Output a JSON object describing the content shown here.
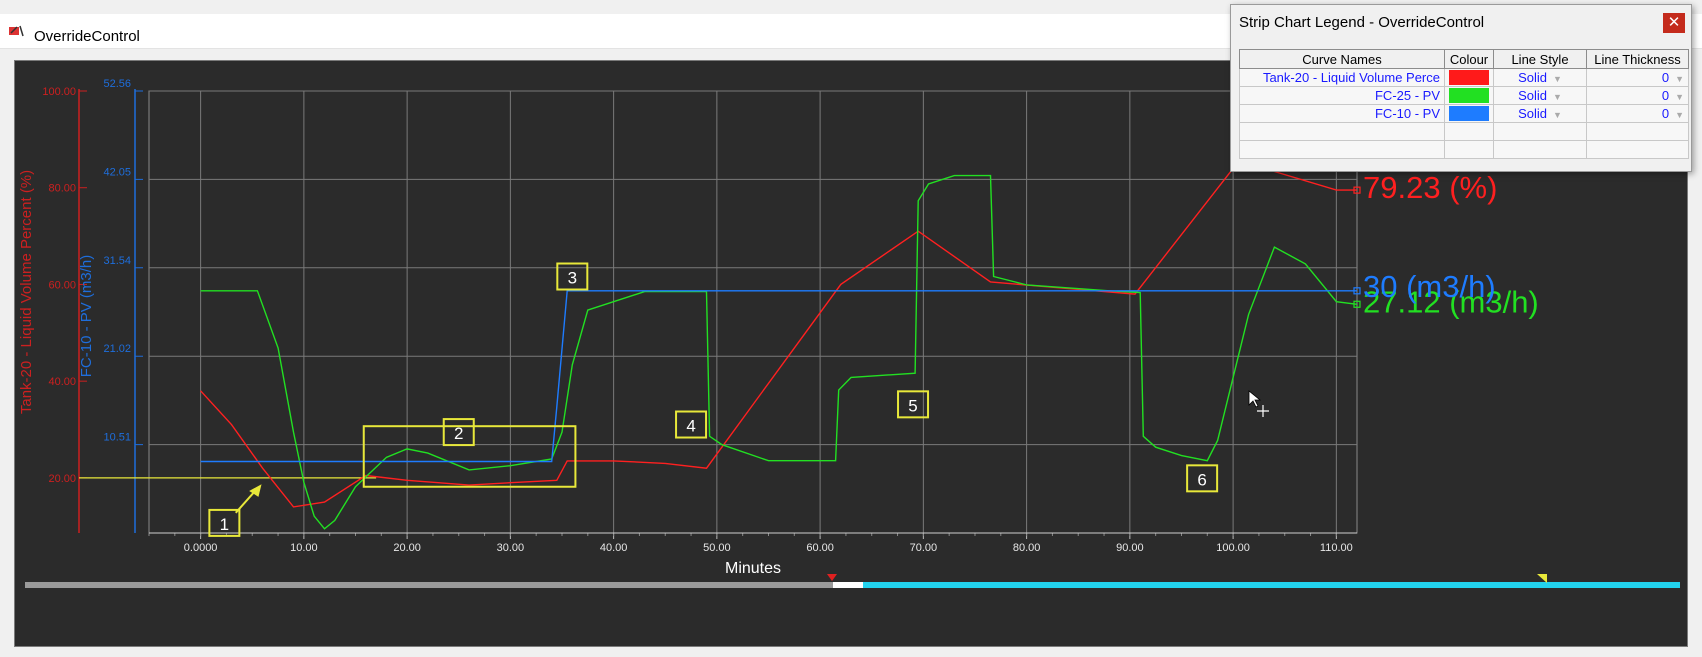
{
  "window": {
    "title": "OverrideControl"
  },
  "legend_window": {
    "title": "Strip Chart Legend - OverrideControl",
    "close_glyph": "✕",
    "columns": [
      "Curve Names",
      "Colour",
      "Line Style",
      "Line Thickness"
    ],
    "rows": [
      {
        "name": "Tank-20 - Liquid Volume Perce",
        "colour": "#ff1a1a",
        "style": "Solid",
        "thickness": "0"
      },
      {
        "name": "FC-25 - PV",
        "colour": "#22e022",
        "style": "Solid",
        "thickness": "0"
      },
      {
        "name": "FC-10 - PV",
        "colour": "#1e7cff",
        "style": "Solid",
        "thickness": "0"
      }
    ]
  },
  "chart_data": {
    "type": "line",
    "xlabel": "Minutes",
    "xlim": [
      -5,
      112
    ],
    "x_ticks": [
      0,
      10,
      20,
      30,
      40,
      50,
      60,
      70,
      80,
      90,
      100,
      110
    ],
    "x_tick_labels": [
      "0.0000",
      "10.00",
      "20.00",
      "30.00",
      "40.00",
      "50.00",
      "60.00",
      "70.00",
      "80.00",
      "90.00",
      "100.00",
      "110.00"
    ],
    "y_axes": [
      {
        "label": "Tank-20 - Liquid Volume Percent (%)",
        "color": "#cc2020",
        "lim": [
          8.6,
          100
        ],
        "ticks": [
          20,
          40,
          60,
          80,
          100
        ],
        "tick_labels": [
          "20.00",
          "40.00",
          "60.00",
          "80.00",
          "100.00"
        ]
      },
      {
        "label": "FC-10 - PV (m3/h)",
        "color": "#1e6edc",
        "lim": [
          0,
          52.56
        ],
        "ticks": [
          10.51,
          21.02,
          31.54,
          42.05,
          52.56
        ],
        "tick_labels": [
          "10.51",
          "21.02",
          "31.54",
          "42.05",
          "52.56"
        ]
      }
    ],
    "grid": true,
    "series": [
      {
        "name": "Tank-20 - Liquid Volume Percent",
        "axis": 0,
        "color": "#ff2020",
        "end_label": "79.23 (%)",
        "x": [
          0,
          3,
          6,
          9,
          12,
          16,
          20,
          26,
          30,
          34.5,
          35.5,
          40,
          45,
          49,
          62,
          69.5,
          76.5,
          90.5,
          100,
          103,
          110,
          112
        ],
        "y": [
          38,
          31,
          22,
          14,
          15,
          20.5,
          19.5,
          18.5,
          19,
          19.5,
          23.5,
          23.5,
          23,
          22,
          60,
          71,
          60.5,
          58,
          84,
          84,
          79.5,
          79.5
        ]
      },
      {
        "name": "FC-25 - PV",
        "axis": 1,
        "color": "#22e022",
        "end_label": "27.12 (m3/h)",
        "x": [
          0,
          5.5,
          7.5,
          9,
          10,
          11,
          12,
          13,
          15,
          18,
          20,
          22,
          26,
          30,
          34,
          35,
          36,
          37.5,
          43,
          49,
          49.3,
          50.5,
          55,
          61.5,
          61.8,
          63,
          69.2,
          69.5,
          70.5,
          73,
          76.5,
          76.8,
          80,
          88,
          91,
          91.3,
          92.5,
          95,
          97.5,
          98.5,
          101.5,
          104,
          107,
          110,
          112
        ],
        "y": [
          28.8,
          28.8,
          22,
          12,
          6,
          2,
          0.5,
          1.5,
          5.5,
          9,
          10,
          9.5,
          7.5,
          8,
          8.8,
          12,
          20,
          26.5,
          28.7,
          28.7,
          11.5,
          10.5,
          8.6,
          8.6,
          17,
          18.5,
          19,
          39.5,
          41.5,
          42.5,
          42.5,
          30.5,
          29.5,
          28.8,
          28.6,
          11.5,
          10.2,
          9.2,
          8.6,
          11,
          26,
          34,
          32,
          27.5,
          27.2
        ]
      },
      {
        "name": "FC-10 - PV",
        "axis": 1,
        "color": "#1e7cff",
        "end_label": "30 (m3/h)",
        "x": [
          0,
          34,
          34.5,
          35.5,
          112
        ],
        "y": [
          8.5,
          8.5,
          15,
          28.8,
          28.8
        ]
      }
    ],
    "threshold_line": {
      "axis": 0,
      "value": 20,
      "x_end": 17
    },
    "annotations": [
      {
        "label": "1",
        "x": 2.3,
        "y": 1.2
      },
      {
        "label": "2",
        "x": 25,
        "y": 12
      },
      {
        "label": "3",
        "x": 36,
        "y": 30.5
      },
      {
        "label": "4",
        "x": 47.5,
        "y": 12.9
      },
      {
        "label": "5",
        "x": 69,
        "y": 15.3
      },
      {
        "label": "6",
        "x": 97,
        "y": 6.5
      }
    ]
  },
  "icons": {
    "window": "override-control-icon",
    "cursor": "move-cursor-icon"
  },
  "scrollbar": {
    "accent_color": "#22d3ee"
  }
}
